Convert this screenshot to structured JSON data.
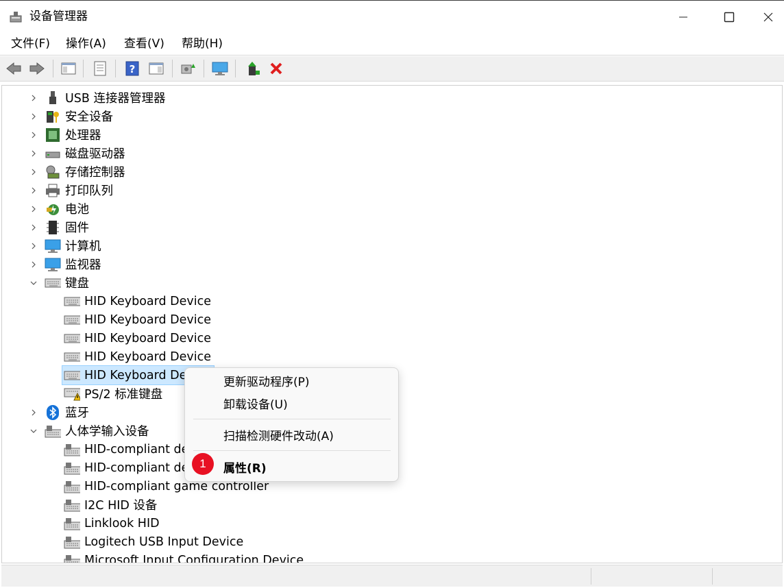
{
  "window": {
    "title": "设备管理器",
    "icon": "device-manager-icon"
  },
  "menu": [
    "文件(F)",
    "操作(A)",
    "查看(V)",
    "帮助(H)"
  ],
  "toolbar": [
    "back-icon",
    "forward-icon",
    "show-hide-console-tree-icon",
    "properties-icon",
    "help-icon",
    "show-hide-action-pane-icon",
    "scan-hardware-icon",
    "computer-monitor-icon",
    "update-driver-icon",
    "uninstall-red-x-icon"
  ],
  "tree": {
    "categories": [
      {
        "label": "USB 连接器管理器",
        "icon": "usb-icon"
      },
      {
        "label": "安全设备",
        "icon": "security-key-icon"
      },
      {
        "label": "处理器",
        "icon": "processor-icon"
      },
      {
        "label": "磁盘驱动器",
        "icon": "disk-drive-icon"
      },
      {
        "label": "存储控制器",
        "icon": "storage-controller-icon"
      },
      {
        "label": "打印队列",
        "icon": "printer-icon"
      },
      {
        "label": "电池",
        "icon": "battery-icon"
      },
      {
        "label": "固件",
        "icon": "firmware-chip-icon"
      },
      {
        "label": "计算机",
        "icon": "computer-icon"
      },
      {
        "label": "监视器",
        "icon": "monitor-icon"
      },
      {
        "label": "键盘",
        "icon": "keyboard-icon"
      }
    ],
    "keyboard_children": [
      "HID Keyboard Device",
      "HID Keyboard Device",
      "HID Keyboard Device",
      "HID Keyboard Device",
      "HID Keyboard Device",
      "PS/2 标准键盘"
    ],
    "bluetooth": "蓝牙",
    "hid_category": "人体学输入设备",
    "hid_children": [
      "HID-compliant device",
      "HID-compliant device",
      "HID-compliant game controller",
      "I2C HID 设备",
      "Linklook HID",
      "Logitech USB Input Device",
      "Microsoft Input Configuration Device"
    ]
  },
  "context_menu": {
    "update_driver": "更新驱动程序(P)",
    "uninstall": "卸载设备(U)",
    "scan": "扫描检测硬件改动(A)",
    "properties": "属性(R)"
  },
  "step_badge": "1",
  "colors": {
    "selection_bg": "#cce8ff",
    "badge": "#e81123",
    "monitor_blue": "#2f9be0"
  }
}
